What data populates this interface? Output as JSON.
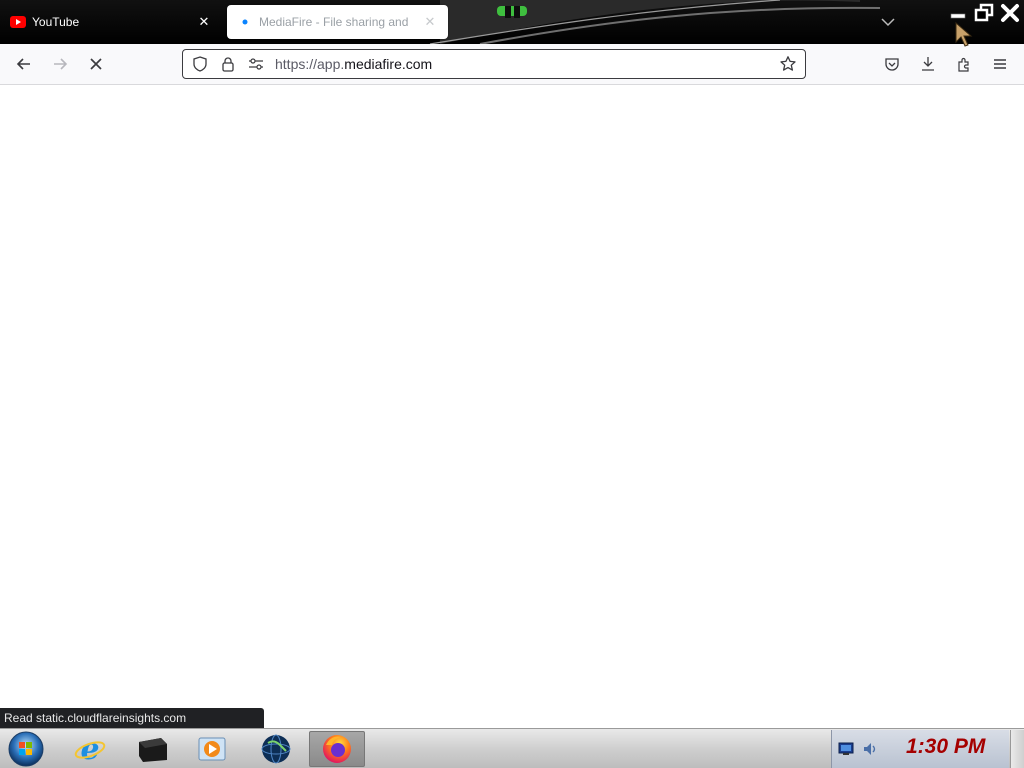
{
  "tabs": [
    {
      "title": "YouTube",
      "favicon": "youtube-icon",
      "active": false
    },
    {
      "title": "MediaFire - File sharing and",
      "favicon": "loading-dot-icon",
      "active": true
    }
  ],
  "navbar": {
    "url_prefix": "https://app.",
    "url_domain": "mediafire.com",
    "back_icon": "arrow-left-icon",
    "forward_icon": "arrow-right-icon",
    "stop_icon": "close-icon"
  },
  "statusbar": {
    "text": "Read static.cloudflareinsights.com"
  },
  "taskbar": {
    "clock": "1:30 PM",
    "apps": [
      "start-orb",
      "internet-explorer-icon",
      "drive-icon",
      "media-player-icon",
      "globe-icon",
      "firefox-icon"
    ]
  },
  "colors": {
    "tabstrip_bg": "#000000",
    "navbar_bg": "#f9f9fb",
    "clock_red": "#a50000",
    "youtube_red": "#ff0000",
    "loading_blue": "#0a84ff"
  }
}
